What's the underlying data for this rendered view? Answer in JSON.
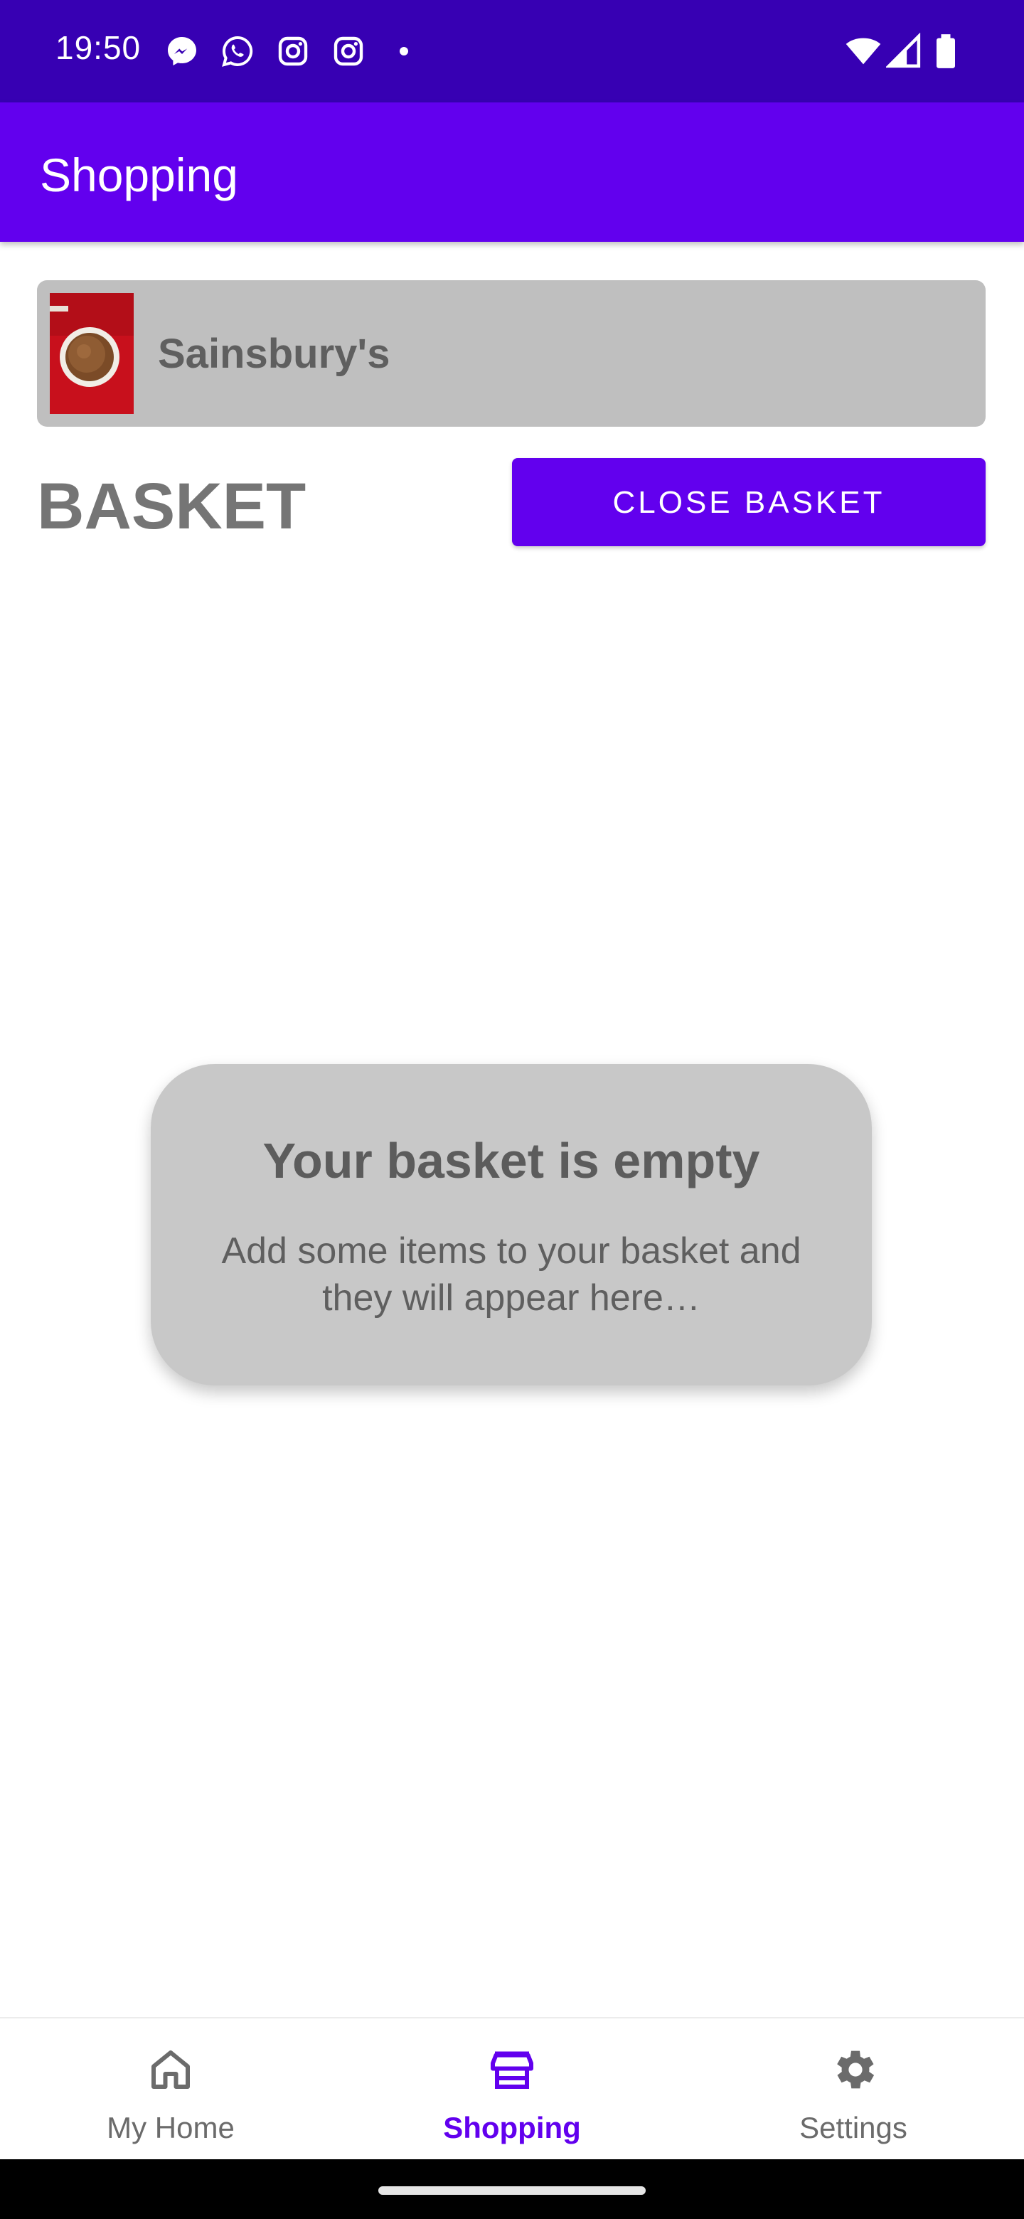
{
  "status_bar": {
    "time": "19:50",
    "notification_icons": [
      "messenger-icon",
      "whatsapp-icon",
      "instagram-icon",
      "instagram-icon",
      "more-notifications-dot"
    ],
    "system_icons": [
      "wifi-icon",
      "cellular-signal-icon",
      "battery-icon"
    ]
  },
  "app_bar": {
    "title": "Shopping"
  },
  "store": {
    "name": "Sainsbury's",
    "thumbnail": "coffee-cup-image"
  },
  "basket": {
    "title": "BASKET",
    "close_button": "CLOSE BASKET"
  },
  "empty_state": {
    "title": "Your basket is empty",
    "message": "Add some items to your basket and they will appear here…"
  },
  "bottom_nav": {
    "items": [
      {
        "label": "My Home",
        "icon": "home-icon",
        "active": false
      },
      {
        "label": "Shopping",
        "icon": "store-icon",
        "active": true
      },
      {
        "label": "Settings",
        "icon": "gear-icon",
        "active": false
      }
    ]
  },
  "colors": {
    "status_bar": "#3700b3",
    "primary": "#6200ee",
    "card_grey": "#bfbfbf",
    "empty_card": "#c8c8c8",
    "inactive_nav": "#6b6b6b"
  }
}
